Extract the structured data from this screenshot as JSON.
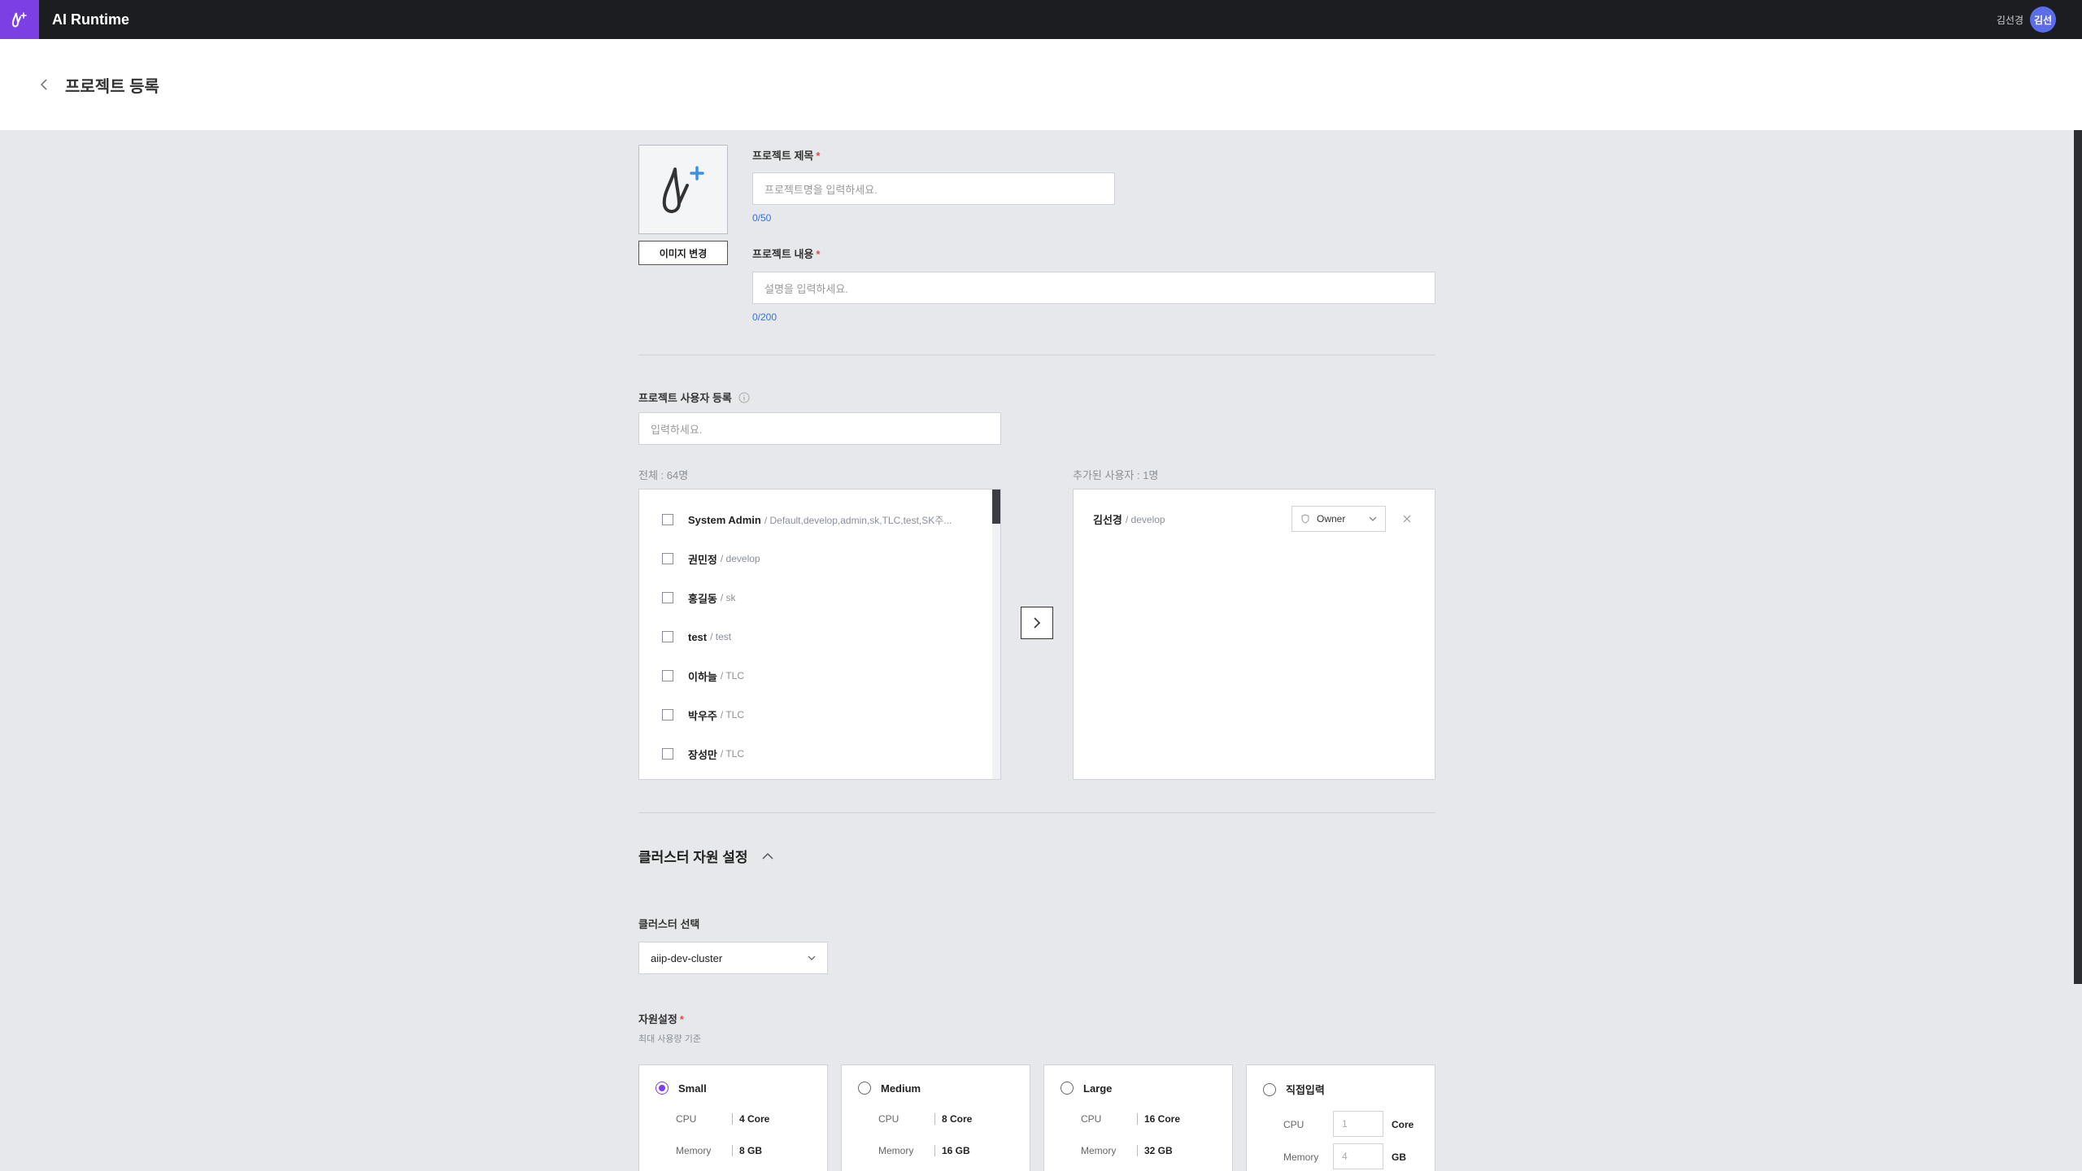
{
  "app": {
    "title": "AI Runtime",
    "user_name": "김선경",
    "avatar_text": "김선"
  },
  "page": {
    "title": "프로젝트 등록"
  },
  "form": {
    "image_change_label": "이미지 변경",
    "title_label": "프로젝트 제목",
    "title_placeholder": "프로젝트명을 입력하세요.",
    "title_counter": "0/50",
    "desc_label": "프로젝트 내용",
    "desc_placeholder": "설명을 입력하세요.",
    "desc_counter": "0/200",
    "required_mark": "*"
  },
  "users": {
    "section_label": "프로젝트 사용자 등록",
    "search_placeholder": "입력하세요.",
    "total_label": "전체 : 64명",
    "added_label": "추가된 사용자 : 1명",
    "list": [
      {
        "name": "System Admin",
        "group": "/ Default,develop,admin,sk,TLC,test,SK주..."
      },
      {
        "name": "권민정",
        "group": "/ develop"
      },
      {
        "name": "홍길동",
        "group": "/ sk"
      },
      {
        "name": "test",
        "group": "/ test"
      },
      {
        "name": "이하늘",
        "group": "/ TLC"
      },
      {
        "name": "박우주",
        "group": "/ TLC"
      },
      {
        "name": "장성만",
        "group": "/ TLC"
      }
    ],
    "added": [
      {
        "name": "김선경",
        "group": "/ develop",
        "role": "Owner"
      }
    ]
  },
  "cluster": {
    "section_title": "클러스터 자원 설정",
    "select_label": "클러스터 선택",
    "selected_cluster": "aiip-dev-cluster",
    "resource_label": "자원설정",
    "resource_hint": "최대 사용량 기준",
    "presets": [
      {
        "name": "Small",
        "selected": true,
        "cpu_label": "CPU",
        "cpu": "4 Core",
        "mem_label": "Memory",
        "mem": "8 GB"
      },
      {
        "name": "Medium",
        "selected": false,
        "cpu_label": "CPU",
        "cpu": "8 Core",
        "mem_label": "Memory",
        "mem": "16 GB"
      },
      {
        "name": "Large",
        "selected": false,
        "cpu_label": "CPU",
        "cpu": "16 Core",
        "mem_label": "Memory",
        "mem": "32 GB"
      }
    ],
    "custom": {
      "name": "직접입력",
      "selected": false,
      "cpu_label": "CPU",
      "cpu_placeholder": "1",
      "cpu_unit": "Core",
      "mem_label": "Memory",
      "mem_placeholder": "4",
      "mem_unit": "GB"
    }
  },
  "colors": {
    "accent": "#7b3fe4",
    "topbar": "#1c1d21",
    "avatar": "#5b6ee8",
    "link": "#3a6fd8",
    "required": "#e24b4b"
  }
}
